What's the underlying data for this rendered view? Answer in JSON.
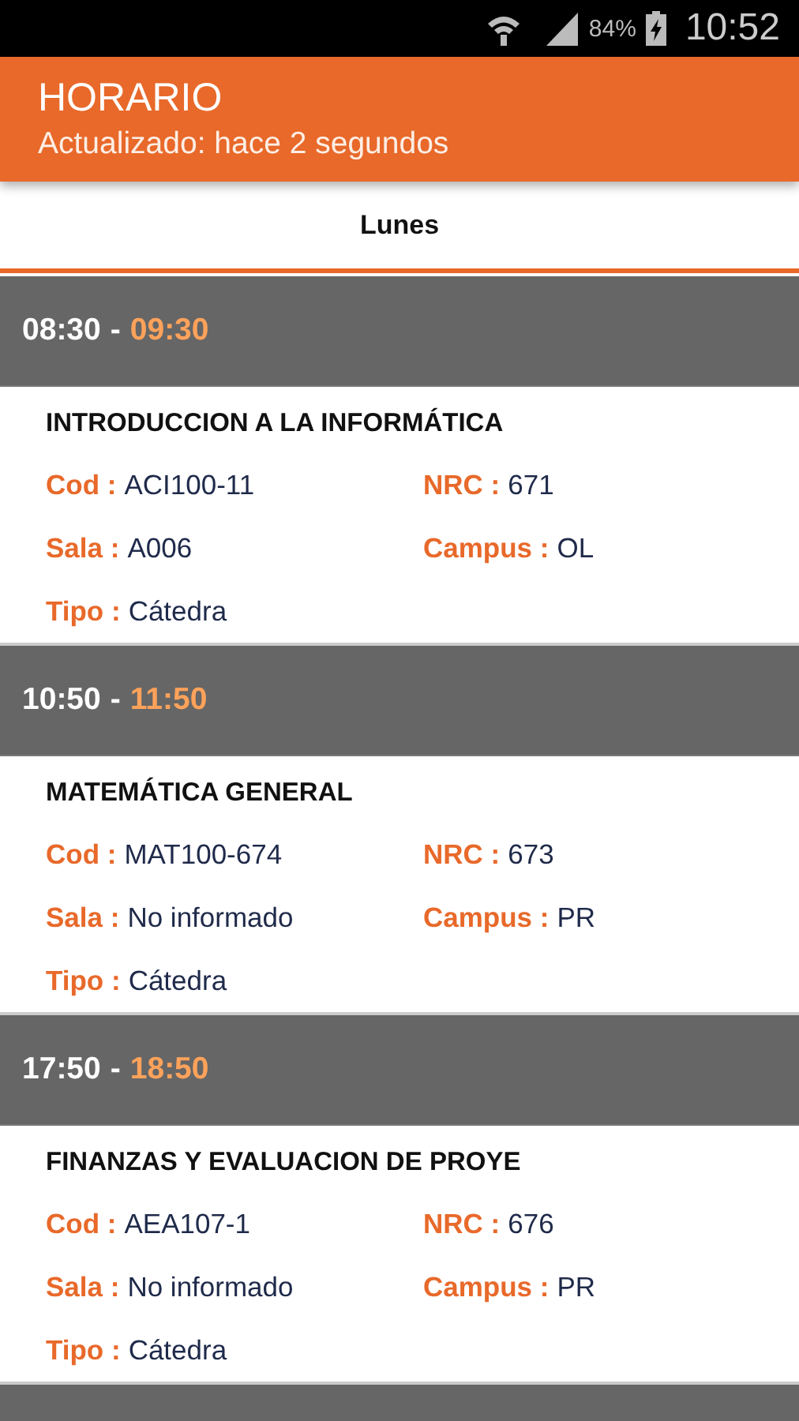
{
  "status_bar": {
    "battery": "84%",
    "time": "10:52"
  },
  "header": {
    "title": "HORARIO",
    "subtitle": "Actualizado: hace 2 segundos"
  },
  "tabs": [
    {
      "label": "Lunes",
      "selected": true
    }
  ],
  "blocks": [
    {
      "start": "08:30",
      "separator": "-",
      "end": "09:30",
      "title": "INTRODUCCION A LA INFORMÁTICA",
      "fields": [
        {
          "label": "Cod :",
          "value": "ACI100-11"
        },
        {
          "label": "NRC :",
          "value": "671"
        },
        {
          "label": "Sala :",
          "value": "A006"
        },
        {
          "label": "Campus :",
          "value": "OL"
        },
        {
          "label": "Tipo :",
          "value": "Cátedra"
        }
      ]
    },
    {
      "start": "10:50",
      "separator": "-",
      "end": "11:50",
      "title": "MATEMÁTICA GENERAL",
      "fields": [
        {
          "label": "Cod :",
          "value": "MAT100-674"
        },
        {
          "label": "NRC :",
          "value": "673"
        },
        {
          "label": "Sala :",
          "value": "No informado"
        },
        {
          "label": "Campus :",
          "value": "PR"
        },
        {
          "label": "Tipo :",
          "value": "Cátedra"
        }
      ]
    },
    {
      "start": "17:50",
      "separator": "-",
      "end": "18:50",
      "title": "FINANZAS Y EVALUACION DE PROYE",
      "fields": [
        {
          "label": "Cod :",
          "value": "AEA107-1"
        },
        {
          "label": "NRC :",
          "value": "676"
        },
        {
          "label": "Sala :",
          "value": "No informado"
        },
        {
          "label": "Campus :",
          "value": "PR"
        },
        {
          "label": "Tipo :",
          "value": "Cátedra"
        }
      ]
    }
  ]
}
